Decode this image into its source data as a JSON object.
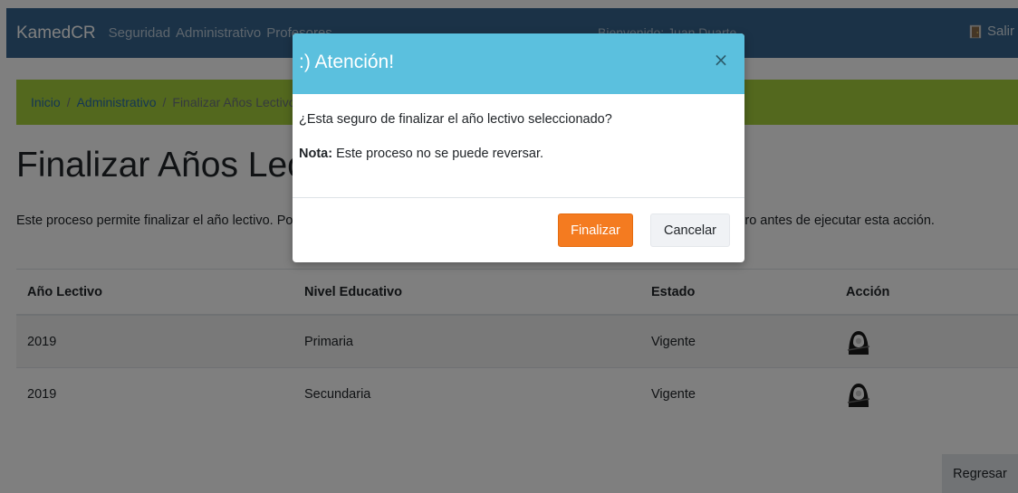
{
  "navbar": {
    "brand": "KamedCR",
    "links": [
      "Seguridad",
      "Administrativo",
      "Profesores"
    ],
    "welcome": "Bienvenido: Juan Duarte",
    "logout_label": "Salir",
    "logout_icon": "door-exit-icon"
  },
  "breadcrumb": {
    "items": [
      "Inicio",
      "Administrativo",
      "Finalizar Años Lectivos"
    ],
    "separator": "/"
  },
  "page": {
    "title": "Finalizar Años Lectivos",
    "description": "Este proceso permite finalizar el año lectivo. Por favor verifique cada uno de los datos mostrados y esté completamente seguro antes de ejecutar esta acción."
  },
  "table": {
    "headers": [
      "Año Lectivo",
      "Nivel Educativo",
      "Estado",
      "Acción"
    ],
    "rows": [
      {
        "year": "2019",
        "level": "Primaria",
        "status": "Vigente",
        "action_icon": "grim-reaper-icon"
      },
      {
        "year": "2019",
        "level": "Secundaria",
        "status": "Vigente",
        "action_icon": "grim-reaper-icon"
      }
    ]
  },
  "back_button": "Regresar",
  "modal": {
    "title": ":) Atención!",
    "close_label": "×",
    "question": "¿Esta seguro de finalizar el año lectivo seleccionado?",
    "note_label": "Nota:",
    "note_text": " Este proceso no se puede reversar.",
    "confirm_label": "Finalizar",
    "cancel_label": "Cancelar"
  },
  "colors": {
    "navbar": "#36658f",
    "breadcrumb": "#a6d13d",
    "modal_header": "#5bc0de",
    "finalizar": "#f47b20"
  }
}
